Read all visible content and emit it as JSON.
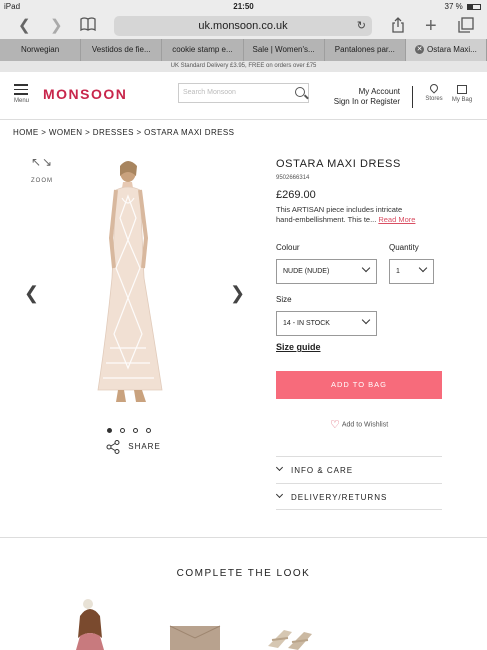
{
  "status": {
    "device": "iPad",
    "time": "21:50",
    "battery": "37 %"
  },
  "browser": {
    "url": "uk.monsoon.co.uk"
  },
  "tabs": [
    {
      "label": "Norwegian"
    },
    {
      "label": "Vestidos de fie..."
    },
    {
      "label": "cookie stamp e..."
    },
    {
      "label": "Sale | Women's..."
    },
    {
      "label": "Pantalones par..."
    },
    {
      "label": "Ostara Maxi..."
    }
  ],
  "promo": "UK Standard Delivery £3.95, FREE on orders over £75",
  "header": {
    "menu_label": "Menu",
    "logo": "MONSOON",
    "search_placeholder": "Search Monsoon",
    "account": "My Account",
    "signin": "Sign In or Register",
    "stores": "Stores",
    "bag": "My Bag"
  },
  "breadcrumb": "HOME > WOMEN > DRESSES > OSTARA MAXI DRESS",
  "gallery": {
    "zoom": "ZOOM",
    "share": "SHARE"
  },
  "product": {
    "title": "OSTARA MAXI DRESS",
    "sku": "9502666314",
    "price": "£269.00",
    "desc_line1": "This ARTISAN piece includes intricate",
    "desc_line2": "hand-embellishment. This te...",
    "read_more": "Read More",
    "colour_label": "Colour",
    "colour_value": "NUDE (NUDE)",
    "quantity_label": "Quantity",
    "quantity_value": "1",
    "size_label": "Size",
    "size_value": "14 - IN STOCK",
    "size_guide": "Size guide",
    "add_to_bag": "ADD TO BAG",
    "wishlist": "Add to Wishlist",
    "info_care": "INFO & CARE",
    "delivery": "DELIVERY/RETURNS"
  },
  "complete_look": "COMPLETE THE LOOK"
}
